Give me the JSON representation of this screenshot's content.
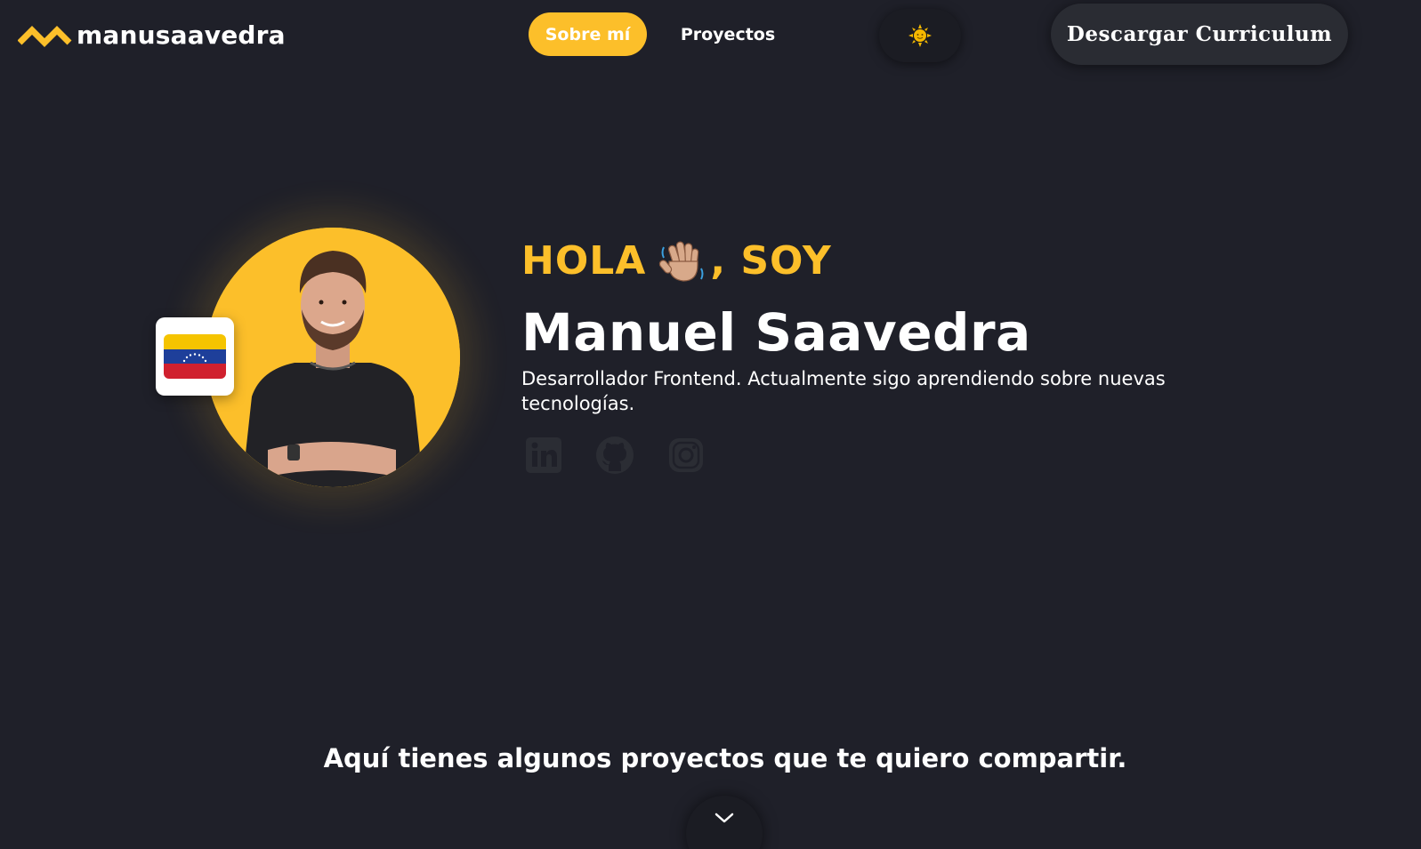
{
  "header": {
    "logo_text": "manusaavedra",
    "nav": [
      {
        "label": "Sobre mí",
        "active": true
      },
      {
        "label": "Proyectos",
        "active": false
      }
    ],
    "theme_toggle_icon": "sun-icon",
    "download_cv_label": "Descargar Curriculum"
  },
  "hero": {
    "greeting_prefix": "HOLA",
    "greeting_emoji": "waving-hand-icon",
    "greeting_suffix": ", SOY",
    "name": "Manuel Saavedra",
    "tagline": "Desarrollador Frontend. Actualmente sigo aprendiendo sobre nuevas tecnologías.",
    "flag": "venezuela-flag-icon",
    "socials": [
      "linkedin-icon",
      "github-icon",
      "instagram-icon"
    ]
  },
  "projects_prompt": "Aquí tienes algunos proyectos que te quiero compartir.",
  "colors": {
    "background": "#1f2029",
    "accent": "#fcbf2a",
    "text": "#ffffff",
    "button_dark": "#2a2c33"
  }
}
